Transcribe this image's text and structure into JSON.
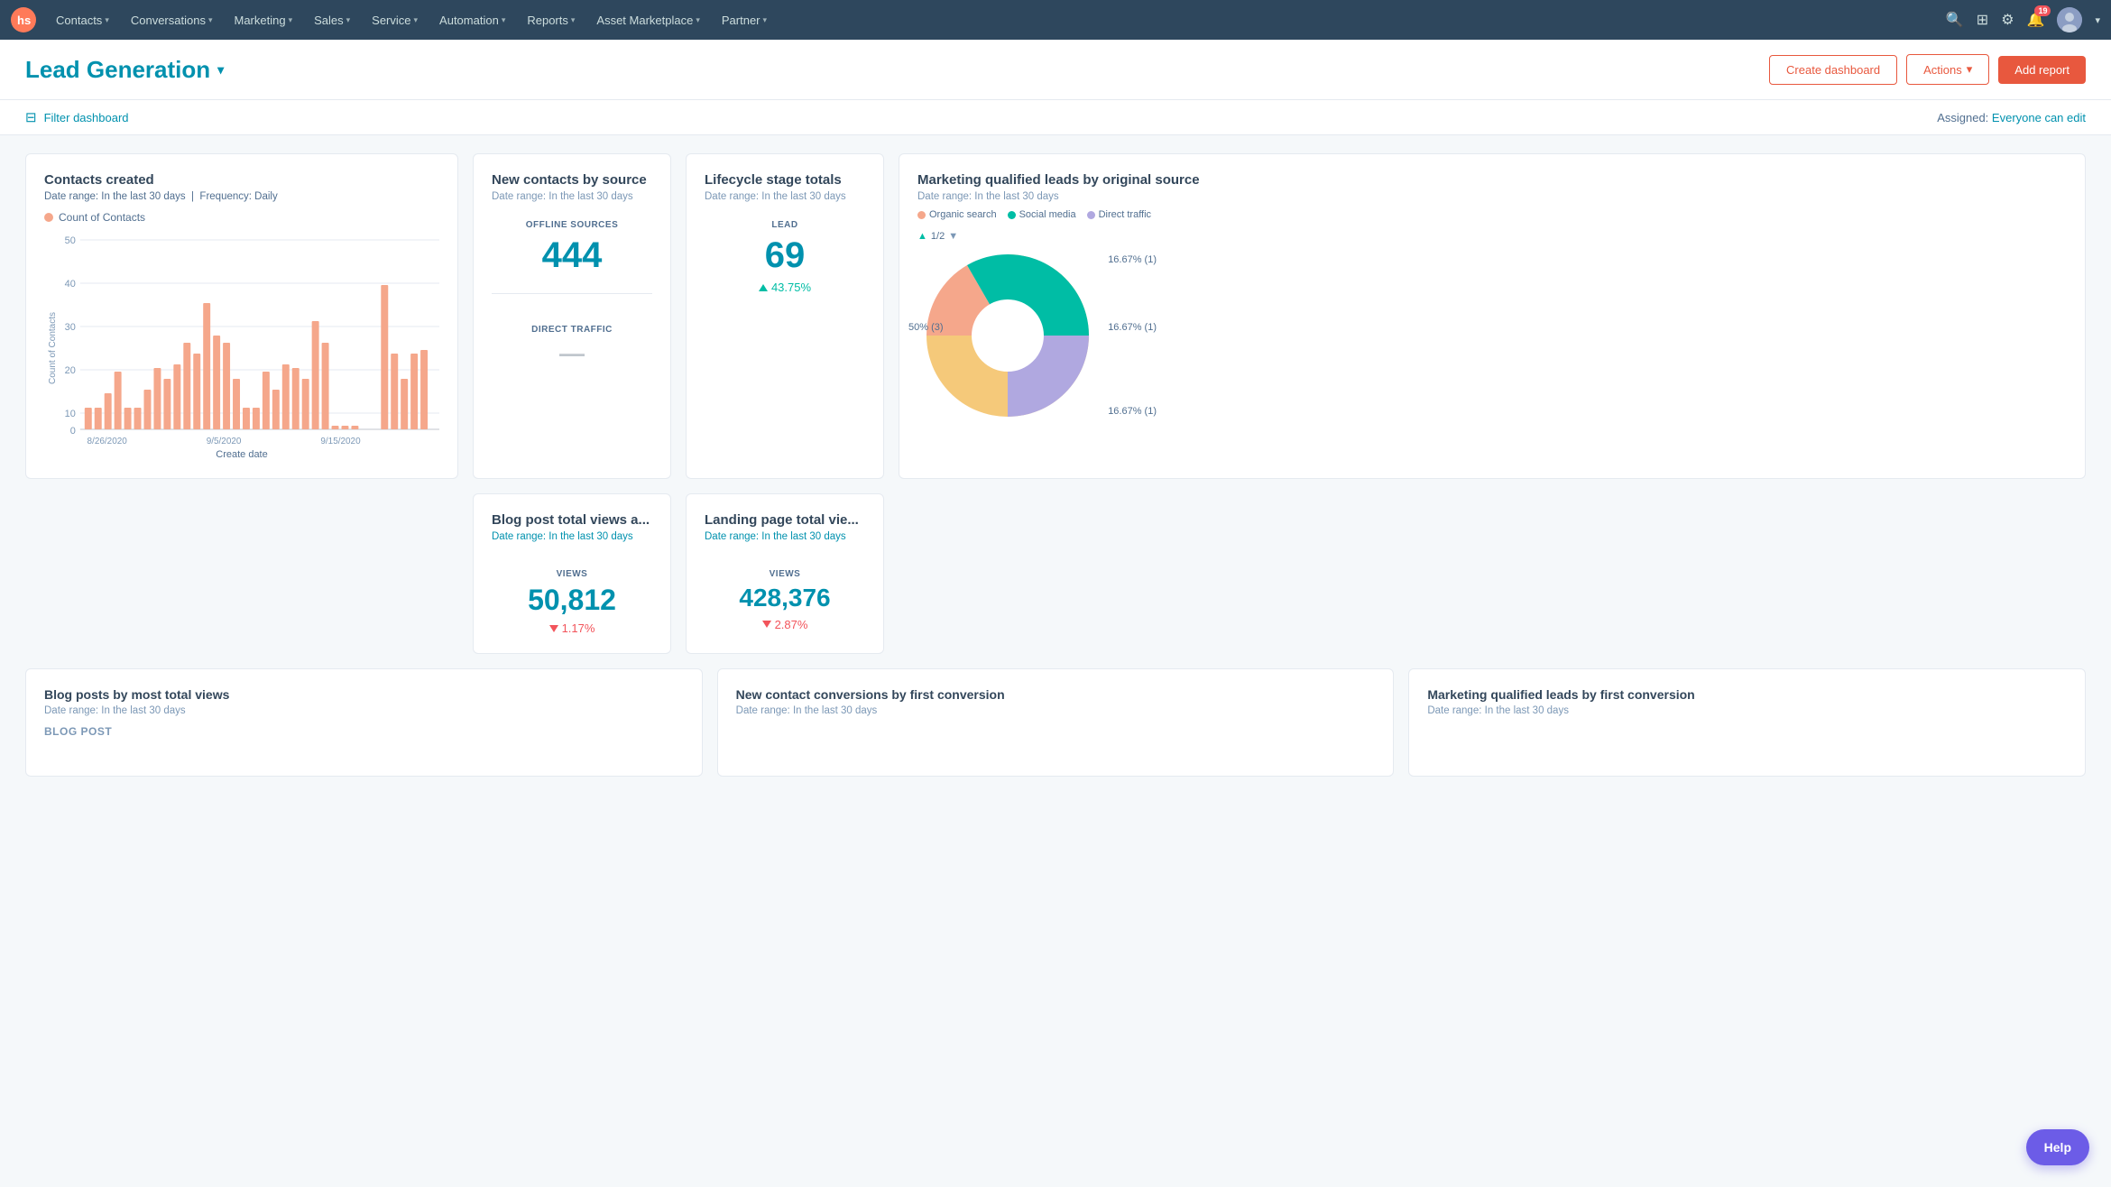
{
  "nav": {
    "logo_alt": "HubSpot",
    "items": [
      {
        "label": "Contacts",
        "has_caret": true
      },
      {
        "label": "Conversations",
        "has_caret": true
      },
      {
        "label": "Marketing",
        "has_caret": true
      },
      {
        "label": "Sales",
        "has_caret": true
      },
      {
        "label": "Service",
        "has_caret": true
      },
      {
        "label": "Automation",
        "has_caret": true
      },
      {
        "label": "Reports",
        "has_caret": true
      },
      {
        "label": "Asset Marketplace",
        "has_caret": true
      },
      {
        "label": "Partner",
        "has_caret": true
      }
    ],
    "notification_count": "19",
    "caret_symbol": "▾"
  },
  "header": {
    "title": "Lead Generation",
    "create_dashboard_label": "Create dashboard",
    "actions_label": "Actions",
    "actions_caret": "▾",
    "add_report_label": "Add report"
  },
  "filter_bar": {
    "filter_label": "Filter dashboard",
    "assigned_prefix": "Assigned:",
    "assigned_value": "Everyone can edit"
  },
  "cards": {
    "contacts_created": {
      "title": "Contacts created",
      "date_range": "Date range: In the last 30 days",
      "separator": "|",
      "frequency": "Frequency: Daily",
      "legend_label": "Count of Contacts",
      "y_labels": [
        "50",
        "40",
        "30",
        "20",
        "10",
        "0"
      ],
      "x_labels": [
        "8/26/2020",
        "9/5/2020",
        "9/15/2020"
      ],
      "x_axis_label": "Create date",
      "bars": [
        6,
        6,
        10,
        16,
        6,
        6,
        11,
        17,
        14,
        18,
        24,
        21,
        35,
        26,
        24,
        14,
        6,
        6,
        16,
        11,
        18,
        17,
        14,
        30,
        24,
        1,
        1,
        1,
        0,
        0,
        40,
        21,
        14,
        21,
        22
      ],
      "bar_color": "#f5a78b"
    },
    "new_contacts_source": {
      "title": "New contacts by source",
      "date_range": "Date range: In the last 30 days",
      "metrics": [
        {
          "label": "OFFLINE SOURCES",
          "value": "444",
          "change": null
        },
        {
          "label": "DIRECT TRAFFIC",
          "value": null,
          "change": null
        }
      ]
    },
    "lifecycle_stage": {
      "title": "Lifecycle stage totals",
      "date_range": "Date range: In the last 30 days",
      "metrics": [
        {
          "label": "LEAD",
          "value": "69",
          "change": "43.75%",
          "direction": "up"
        }
      ]
    },
    "marketing_qualified": {
      "title": "Marketing qualified leads by original source",
      "date_range": "Date range: In the last 30 days",
      "legend": [
        {
          "label": "Organic search",
          "color": "#f5a78b"
        },
        {
          "label": "Social media",
          "color": "#00bda5"
        },
        {
          "label": "Direct traffic",
          "color": "#b0a8e0"
        }
      ],
      "page_indicator": "1/2",
      "pie_segments": [
        {
          "label": "50% (3)",
          "value": 50,
          "color": "#f5c97a",
          "position": "left"
        },
        {
          "label": "16.67% (1)",
          "value": 16.67,
          "color": "#f5a78b",
          "position": "top-right"
        },
        {
          "label": "16.67% (1)",
          "value": 16.67,
          "color": "#00bda5",
          "position": "right"
        },
        {
          "label": "16.67% (1)",
          "value": 16.67,
          "color": "#b0a8e0",
          "position": "bottom-right"
        }
      ]
    },
    "blog_post_views": {
      "title": "Blog post total views a...",
      "date_range": "Date range: In the last 30 days",
      "label": "VIEWS",
      "value": "50,812",
      "change": "1.17%",
      "direction": "down"
    },
    "landing_page_views": {
      "title": "Landing page total vie...",
      "date_range": "Date range: In the last 30 days",
      "label": "VIEWS",
      "value": "428,376",
      "change": "2.87%",
      "direction": "down"
    },
    "bottom_blog_posts": {
      "title": "Blog posts by most total views",
      "date_range": "Date range: In the last 30 days",
      "column_label": "BLOG POST"
    },
    "bottom_conversions": {
      "title": "New contact conversions by first conversion",
      "date_range": "Date range: In the last 30 days"
    },
    "bottom_mql": {
      "title": "Marketing qualified leads by first conversion",
      "date_range": "Date range: In the last 30 days"
    }
  },
  "help": {
    "label": "Help"
  }
}
